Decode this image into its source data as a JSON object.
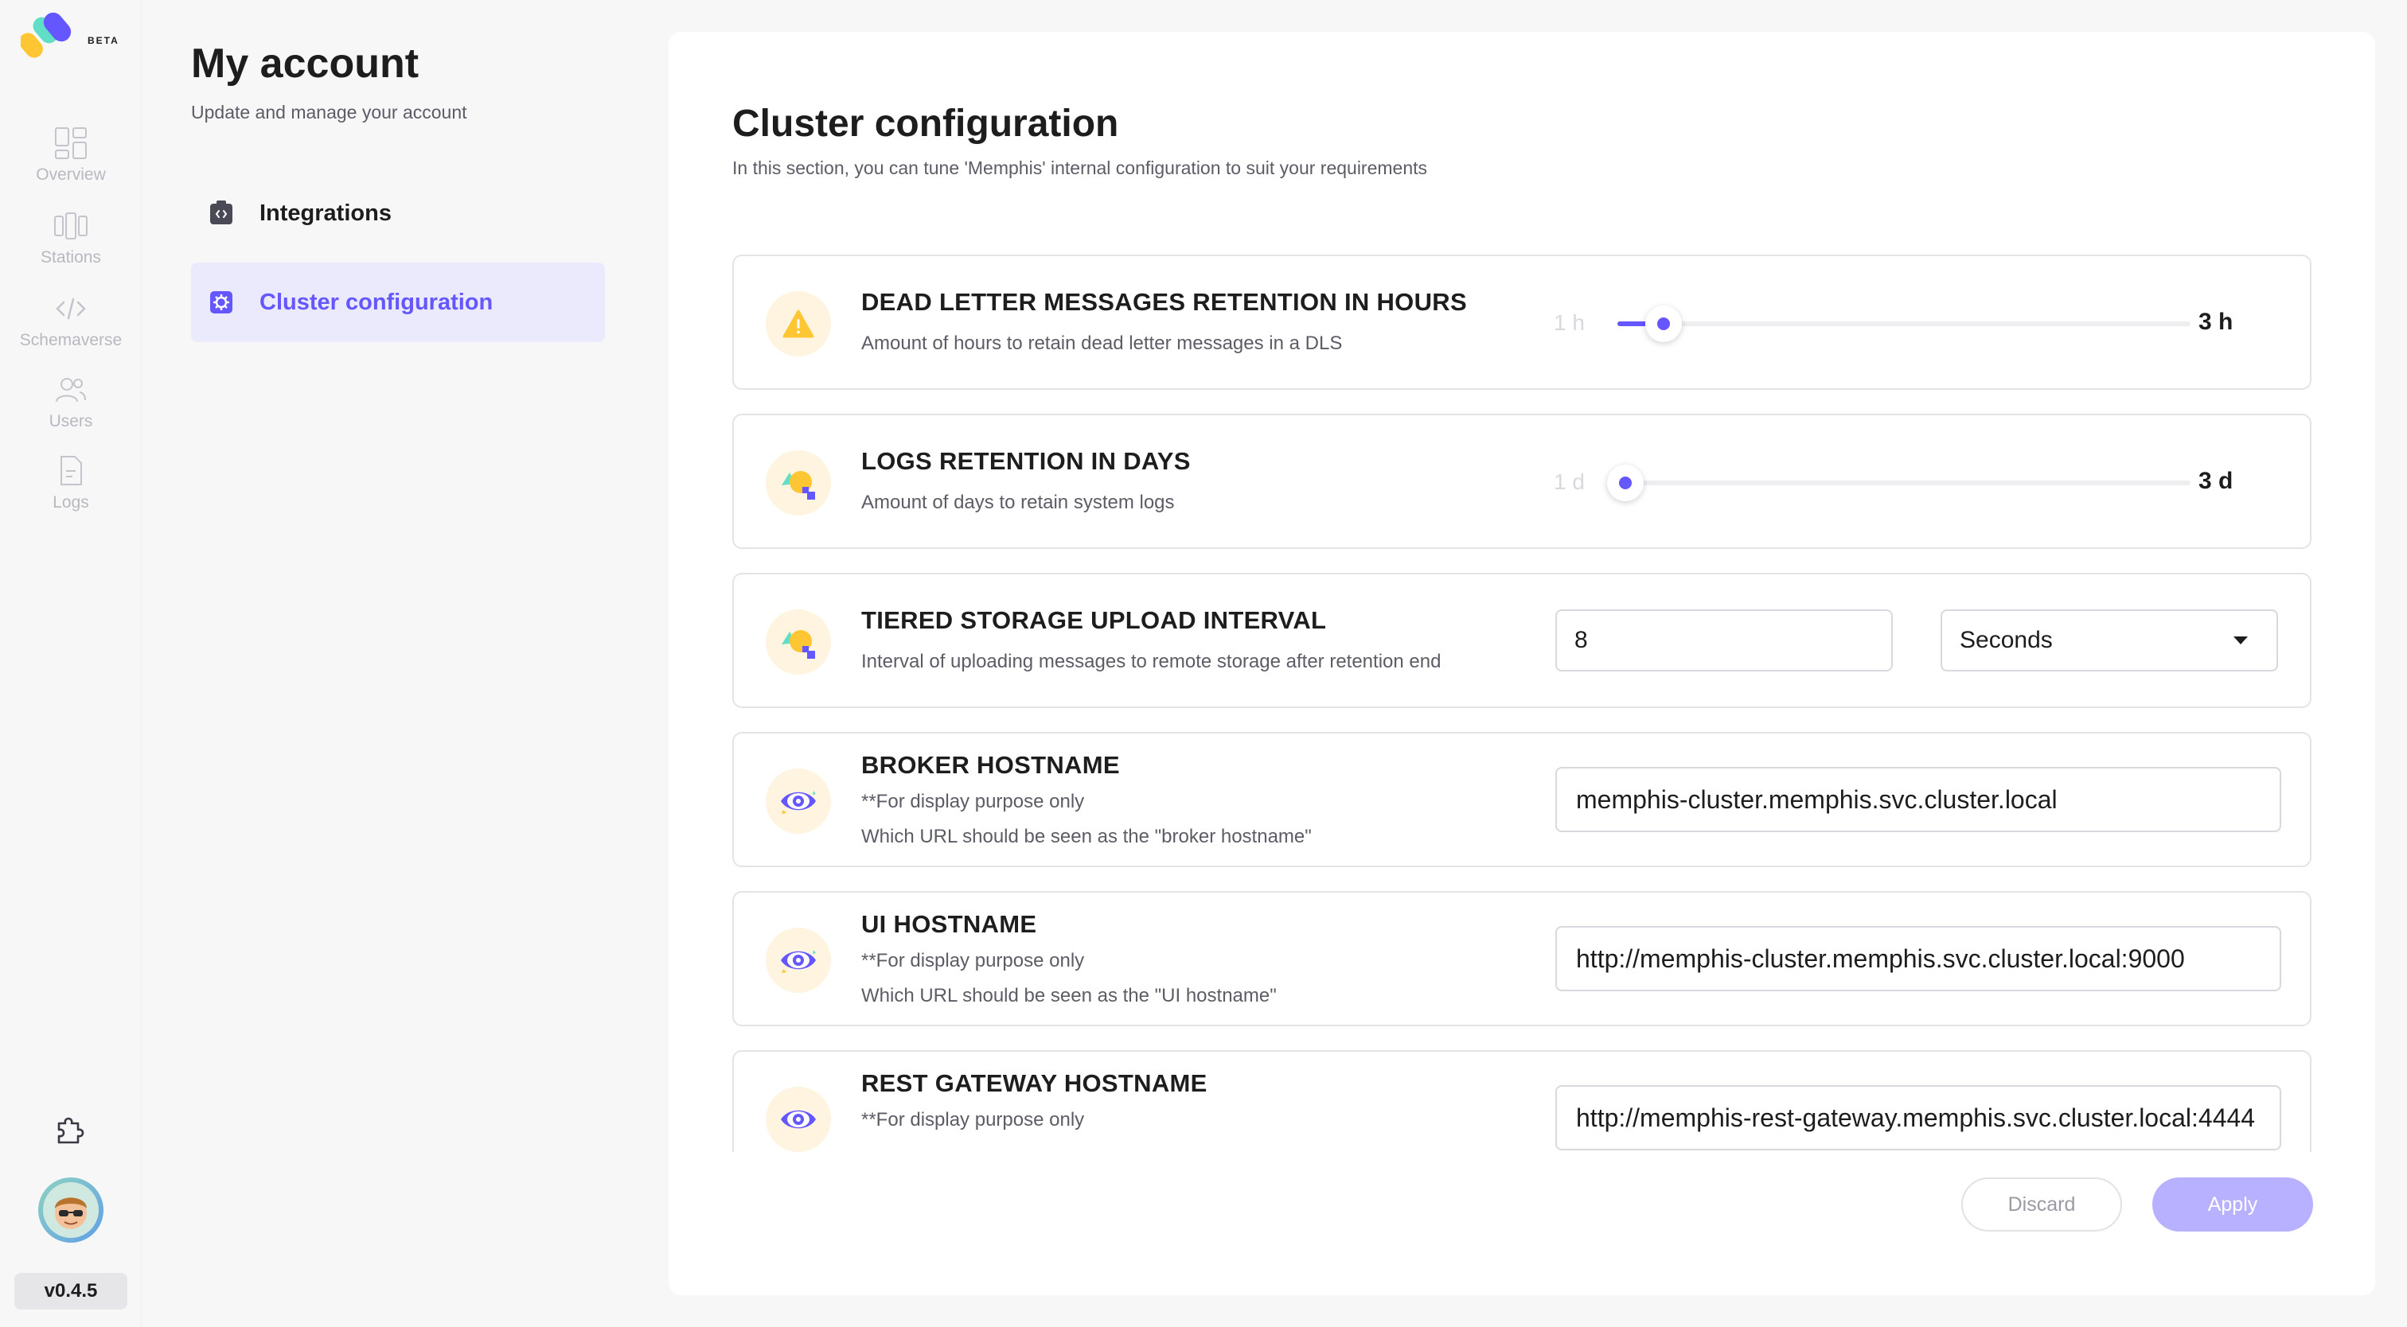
{
  "rail": {
    "logo_badge": "BETA",
    "items": [
      {
        "label": "Overview",
        "icon": "overview-icon"
      },
      {
        "label": "Stations",
        "icon": "stations-icon"
      },
      {
        "label": "Schemaverse",
        "icon": "code-icon"
      },
      {
        "label": "Users",
        "icon": "users-icon"
      },
      {
        "label": "Logs",
        "icon": "logs-icon"
      }
    ],
    "bottom_icon": "puzzle-icon",
    "version": "v0.4.5"
  },
  "account": {
    "title": "My account",
    "subtitle": "Update and manage your account",
    "menu": [
      {
        "label": "Integrations",
        "icon": "integrations-icon",
        "active": false
      },
      {
        "label": "Cluster configuration",
        "icon": "cluster-config-icon",
        "active": true
      }
    ]
  },
  "main": {
    "title": "Cluster configuration",
    "subtitle": "In this section, you can tune 'Memphis' internal configuration to suit your requirements",
    "settings": [
      {
        "title": "DEAD LETTER MESSAGES RETENTION IN HOURS",
        "desc": "Amount of hours to retain dead letter messages in a DLS",
        "icon": "warning-icon",
        "slider": {
          "min_label": "1 h",
          "value_label": "3 h",
          "value": 3,
          "min": 1,
          "max": 30
        }
      },
      {
        "title": "LOGS RETENTION IN DAYS",
        "desc": "Amount of days to retain system logs",
        "icon": "shapes-icon",
        "slider": {
          "min_label": "1 d",
          "value_label": "3 d",
          "value": 3,
          "min": 3,
          "max": 100
        }
      },
      {
        "title": "TIERED STORAGE UPLOAD INTERVAL",
        "desc": "Interval of uploading messages to remote storage after retention end",
        "icon": "shapes-icon",
        "value": "8",
        "unit": "Seconds"
      },
      {
        "title": "BROKER HOSTNAME",
        "desc": "**For display purpose only",
        "desc2": "Which URL should be seen as the \"broker hostname\"",
        "icon": "eye-icon",
        "value": "memphis-cluster.memphis.svc.cluster.local"
      },
      {
        "title": "UI HOSTNAME",
        "desc": "**For display purpose only",
        "desc2": "Which URL should be seen as the \"UI hostname\"",
        "icon": "eye-icon",
        "value": "http://memphis-cluster.memphis.svc.cluster.local:9000"
      },
      {
        "title": "REST GATEWAY HOSTNAME",
        "desc": "**For display purpose only",
        "icon": "eye-icon",
        "value": "http://memphis-rest-gateway.memphis.svc.cluster.local:4444"
      }
    ],
    "discard_label": "Discard",
    "apply_label": "Apply"
  },
  "colors": {
    "accent": "#6557ff",
    "accent_light": "#b7b1ff",
    "active_menu_bg": "#ebeafc",
    "icon_bg": "#fff4e0"
  }
}
